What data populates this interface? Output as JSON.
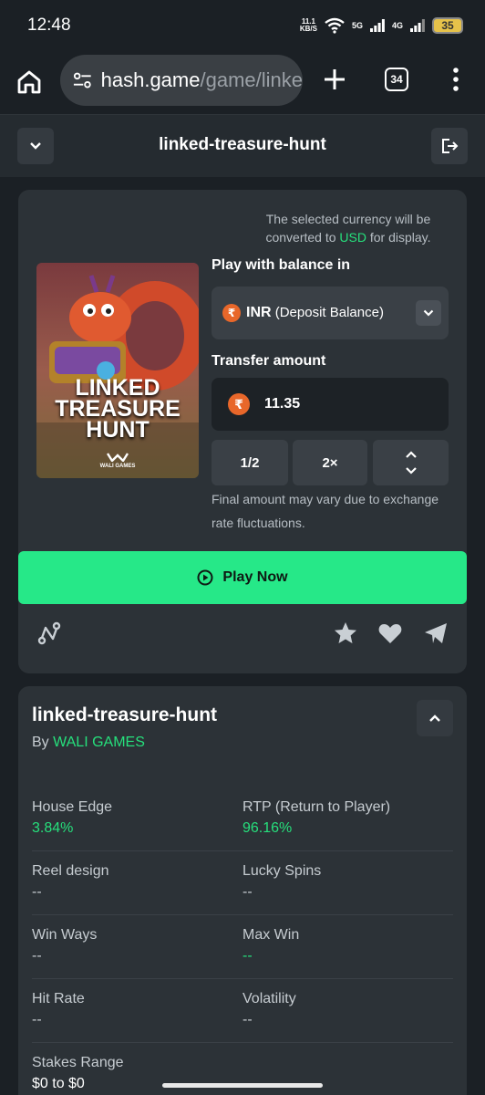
{
  "status_bar": {
    "time": "12:48",
    "speed_value": "11.1",
    "speed_unit": "KB/S",
    "net1": "5G",
    "net2": "4G",
    "battery": "35"
  },
  "browser": {
    "url_host": "hash.game",
    "url_path": "/game/linke",
    "tab_count": "34"
  },
  "game_header": {
    "title": "linked-treasure-hunt"
  },
  "play_card": {
    "currency_note_pre": "The selected currency will be converted to ",
    "currency_note_usd": "USD",
    "currency_note_post": " for display.",
    "thumbnail": {
      "line1": "LINKED",
      "line2": "TREASURE",
      "line3": "HUNT",
      "logo_text": "WALI GAMES"
    },
    "balance_label": "Play with balance in",
    "currency_symbol": "₹",
    "currency_code": "INR",
    "currency_desc": "(Deposit Balance)",
    "transfer_label": "Transfer amount",
    "amount": "11.35",
    "half_label": "1/2",
    "double_label": "2×",
    "final_note": "Final amount may vary due to exchange rate fluctuations.",
    "play_label": "Play Now"
  },
  "icons": {
    "provably_fair": "route-icon",
    "favorite": "star-icon",
    "like": "heart-icon",
    "share": "telegram-icon"
  },
  "info_card": {
    "title": "linked-treasure-hunt",
    "by_prefix": "By ",
    "provider": "WALI GAMES",
    "stats": [
      {
        "label": "House Edge",
        "value": "3.84%"
      },
      {
        "label": "RTP (Return to Player)",
        "value": "96.16%"
      },
      {
        "label": "Reel design",
        "value": "--"
      },
      {
        "label": "Lucky Spins",
        "value": "--"
      },
      {
        "label": "Win Ways",
        "value": "--"
      },
      {
        "label": "Max Win",
        "value": "--"
      },
      {
        "label": "Hit Rate",
        "value": "--"
      },
      {
        "label": "Volatility",
        "value": "--"
      },
      {
        "label": "Stakes Range",
        "value": "$0 to $0"
      }
    ]
  },
  "colors": {
    "accent_green": "#26e888",
    "background": "#1b2025",
    "card": "#2c3237"
  }
}
